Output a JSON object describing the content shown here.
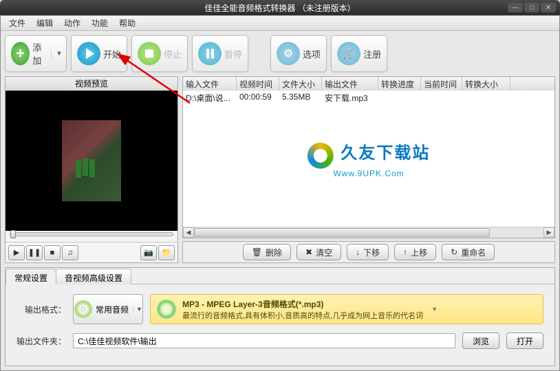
{
  "window": {
    "title": "佳佳全能音频格式转换器   （未注册版本）"
  },
  "menu": [
    "文件",
    "编辑",
    "动作",
    "功能",
    "帮助"
  ],
  "toolbar": {
    "add": "添加",
    "start": "开始",
    "stop": "停止",
    "pause": "暂停",
    "options": "选项",
    "register": "注册"
  },
  "preview": {
    "title": "视频预览"
  },
  "table": {
    "headers": [
      "输入文件",
      "视频时间",
      "文件大小",
      "输出文件",
      "转换进度",
      "当前时间",
      "转换大小"
    ],
    "rows": [
      {
        "c0": "D:\\桌面\\说...",
        "c1": "00:00:59",
        "c2": "5.35MB",
        "c3": "安下载.mp3",
        "c4": "",
        "c5": "",
        "c6": ""
      }
    ],
    "watermark": {
      "cn": "久友下载站",
      "en": "Www.9UPK.Com"
    }
  },
  "actions": {
    "delete": "删除",
    "clear": "清空",
    "down": "下移",
    "up": "上移",
    "rename": "重命名"
  },
  "tabs": {
    "general": "常规设置",
    "advanced": "音视频高级设置"
  },
  "form": {
    "outfmt_label": "输出格式：",
    "common_audio": "常用音频",
    "fmt_title": "MP3 - MPEG Layer-3音频格式(*.mp3)",
    "fmt_desc": "最流行的音频格式,具有体积小,音质高的特点,几乎成为网上音乐的代名词",
    "outdir_label": "输出文件夹：",
    "outdir_value": "C:\\佳佳视频软件\\输出",
    "browse": "浏览",
    "open": "打开"
  }
}
